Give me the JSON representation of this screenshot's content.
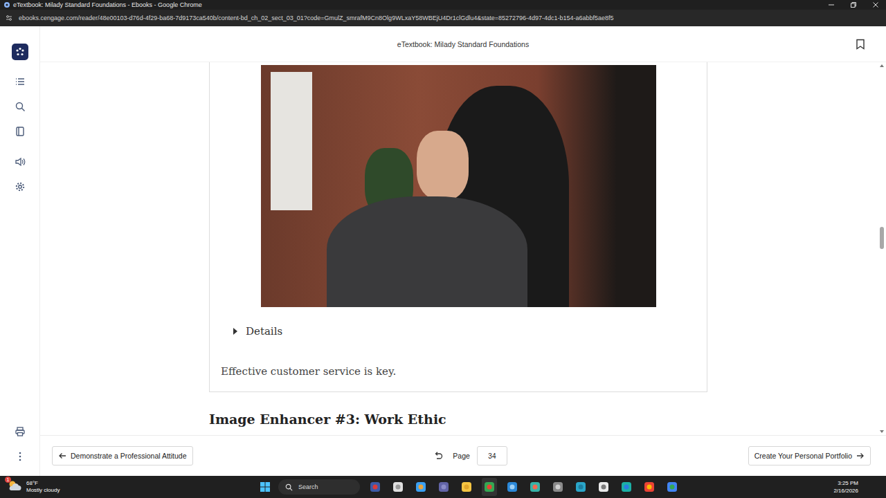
{
  "window": {
    "title": "eTextbook: Milady Standard Foundations - Ebooks - Google Chrome"
  },
  "address_bar": {
    "url": "ebooks.cengage.com/reader/48e00103-d76d-4f29-ba68-7d9173ca540b/content-bd_ch_02_sect_03_01?code=GmulZ_smrafM9Cn8Olg9WLxaY58WBEjU4Dr1clGdlu4&state=85272796-4d97-4dc1-b154-a6abbf5ae8f5"
  },
  "reader": {
    "title": "eTextbook: Milady Standard Foundations",
    "bookmarked": false,
    "scroll_level": 0.44
  },
  "content": {
    "figure": {
      "details": {
        "label": "Details",
        "expanded": false
      },
      "caption": "Effective customer service is key."
    },
    "heading": "Image Enhancer #3: Work Ethic"
  },
  "page_nav": {
    "previous": "Demonstrate a Professional Attitude",
    "page_label": "Page",
    "page": "34",
    "next": "Create Your Personal Portfolio"
  },
  "taskbar": {
    "weather": {
      "temperature": "68°F",
      "condition": "Mostly cloudy",
      "badge": "1"
    },
    "search": {
      "placeholder": "Search"
    },
    "clock": {
      "time": "3:25 PM",
      "date": "2/16/2026"
    }
  }
}
